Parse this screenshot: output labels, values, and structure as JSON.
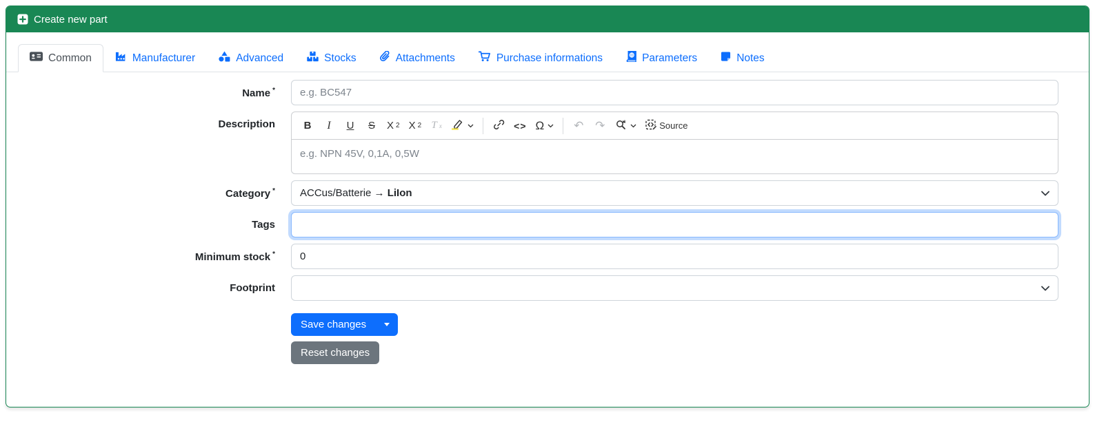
{
  "header": {
    "title": "Create new part",
    "icon": "square-plus-icon"
  },
  "tabs": [
    {
      "label": "Common",
      "icon": "address-card-icon",
      "active": true
    },
    {
      "label": "Manufacturer",
      "icon": "industry-icon",
      "active": false
    },
    {
      "label": "Advanced",
      "icon": "shapes-icon",
      "active": false
    },
    {
      "label": "Stocks",
      "icon": "boxes-stacked-icon",
      "active": false
    },
    {
      "label": "Attachments",
      "icon": "paperclip-icon",
      "active": false
    },
    {
      "label": "Purchase informations",
      "icon": "shopping-cart-icon",
      "active": false
    },
    {
      "label": "Parameters",
      "icon": "book-atlas-icon",
      "active": false
    },
    {
      "label": "Notes",
      "icon": "sticky-note-icon",
      "active": false
    }
  ],
  "form": {
    "name": {
      "label": "Name",
      "required": "*",
      "placeholder": "e.g. BC547",
      "value": ""
    },
    "description": {
      "label": "Description",
      "placeholder": "e.g. NPN 45V, 0,1A, 0,5W",
      "value": ""
    },
    "category": {
      "label": "Category",
      "required": "*",
      "path": "ACCus/Batterie",
      "arrow": "→",
      "selected": "LiIon"
    },
    "tags": {
      "label": "Tags",
      "value": "",
      "focused": true
    },
    "minimum_stock": {
      "label": "Minimum stock",
      "required": "*",
      "value": "0"
    },
    "footprint": {
      "label": "Footprint",
      "value": ""
    }
  },
  "editor_toolbar": {
    "bold": "B",
    "italic": "I",
    "underline": "U",
    "strikethrough": "S",
    "subscript_base": "X",
    "subscript_sub": "2",
    "superscript_base": "X",
    "superscript_sup": "2",
    "remove_format_base": "T",
    "remove_format_sub": "x",
    "code": "<>",
    "special_char": "Ω",
    "undo": "↶",
    "redo": "↷",
    "source_label": "Source",
    "icons": [
      "highlight-marker-icon",
      "link-icon",
      "find-replace-icon",
      "source-editing-icon"
    ]
  },
  "buttons": {
    "save": "Save changes",
    "reset": "Reset changes"
  },
  "colors": {
    "success_green": "#198754",
    "link_blue": "#0d6efd",
    "gray_button": "#6c757d",
    "focus_border": "#86b7fe",
    "input_border": "#ced4da",
    "tab_border": "#dee2e6"
  }
}
